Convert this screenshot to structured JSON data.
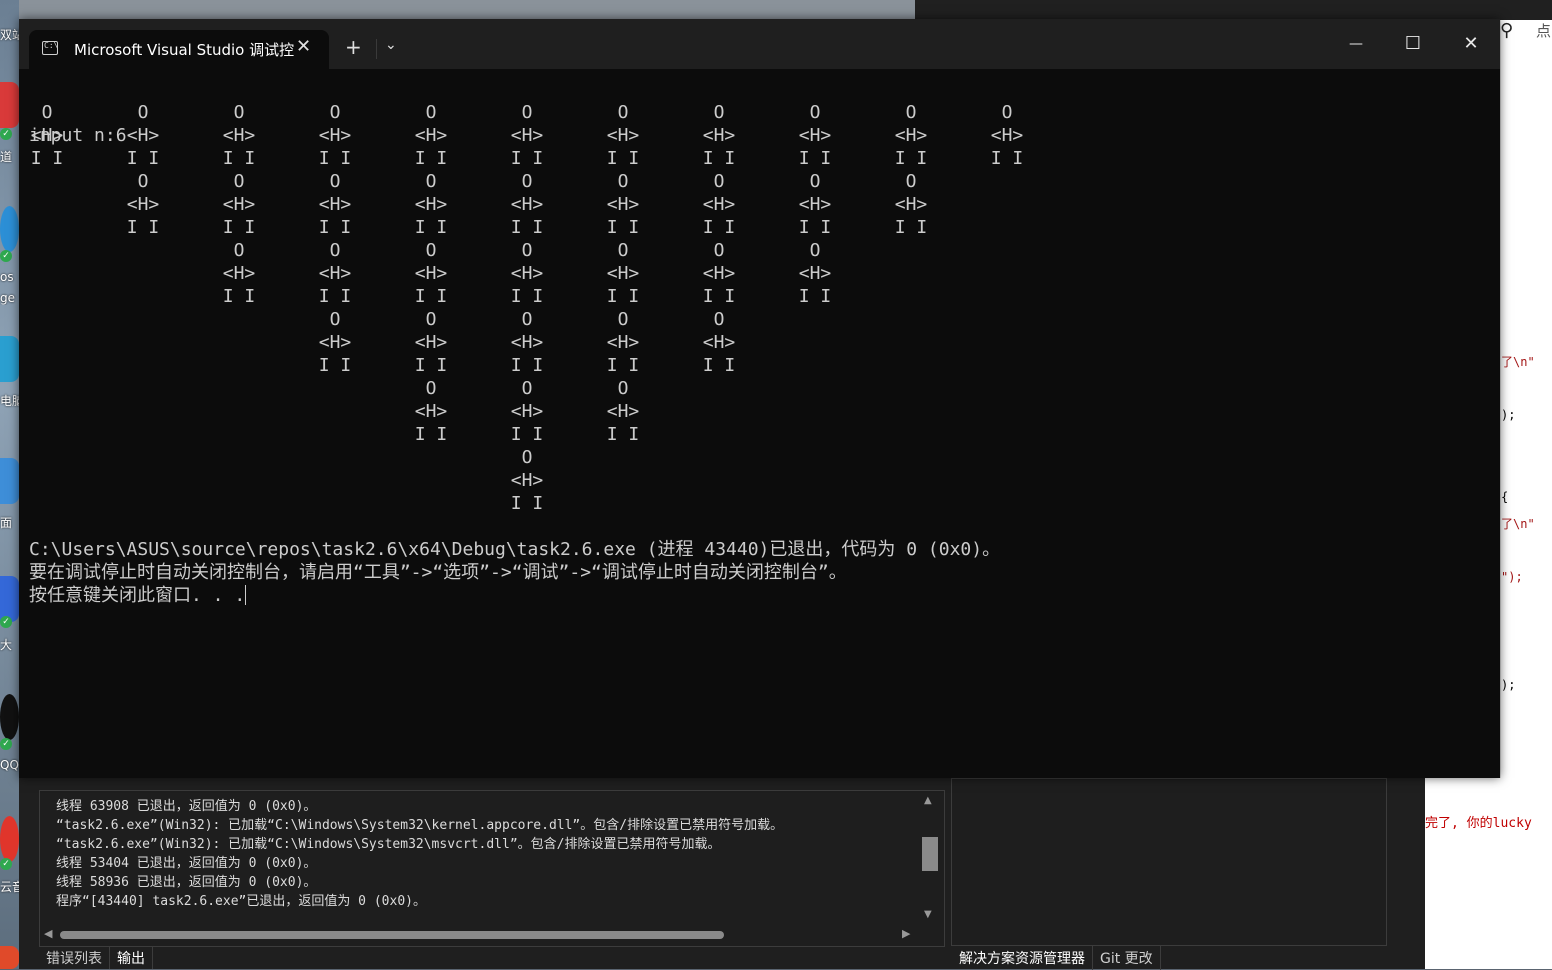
{
  "terminal": {
    "tab_title": "Microsoft Visual Studio 调试控",
    "new_tab_symbol": "+",
    "dropdown_symbol": "⌄",
    "close_symbol": "✕",
    "minimize_symbol": "—",
    "maximize_symbol": "☐",
    "input_line": "input n:6",
    "robot_head": "O",
    "robot_body": "<H>",
    "robot_legs": "I I",
    "robot_columns": [
      1,
      2,
      3,
      4,
      5,
      6,
      5,
      4,
      3,
      2,
      1
    ],
    "exit_line": "C:\\Users\\ASUS\\source\\repos\\task2.6\\x64\\Debug\\task2.6.exe (进程 43440)已退出，代码为 0 (0x0)。",
    "hint_line": "要在调试停止时自动关闭控制台，请启用“工具”->“选项”->“调试”->“调试停止时自动关闭控制台”。",
    "press_key_line": "按任意键关闭此窗口. . ."
  },
  "output_pane": {
    "lines": [
      "线程 63908 已退出，返回值为 0 (0x0)。",
      "“task2.6.exe”(Win32): 已加载“C:\\Windows\\System32\\kernel.appcore.dll”。包含/排除设置已禁用符号加载。",
      "“task2.6.exe”(Win32): 已加载“C:\\Windows\\System32\\msvcrt.dll”。包含/排除设置已禁用符号加载。",
      "线程 53404 已退出，返回值为 0 (0x0)。",
      "线程 58936 已退出，返回值为 0 (0x0)。",
      "程序“[43440] task2.6.exe”已退出，返回值为 0 (0x0)。"
    ],
    "tabs": [
      "错误列表",
      "输出"
    ]
  },
  "solution_tabs": [
    "解决方案资源管理器",
    "Git 更改"
  ],
  "right_editor": {
    "snippets": [
      "了\\n\"",
      ");",
      "{",
      "了\\n\"",
      "\");",
      ");"
    ],
    "bottom_text": "完了, 你的lucky"
  },
  "desktop": {
    "labels": [
      "双站",
      "道",
      "os",
      "ge",
      "电脑",
      "面",
      "大",
      "QQ",
      "云音"
    ]
  },
  "search_glyph": "点"
}
